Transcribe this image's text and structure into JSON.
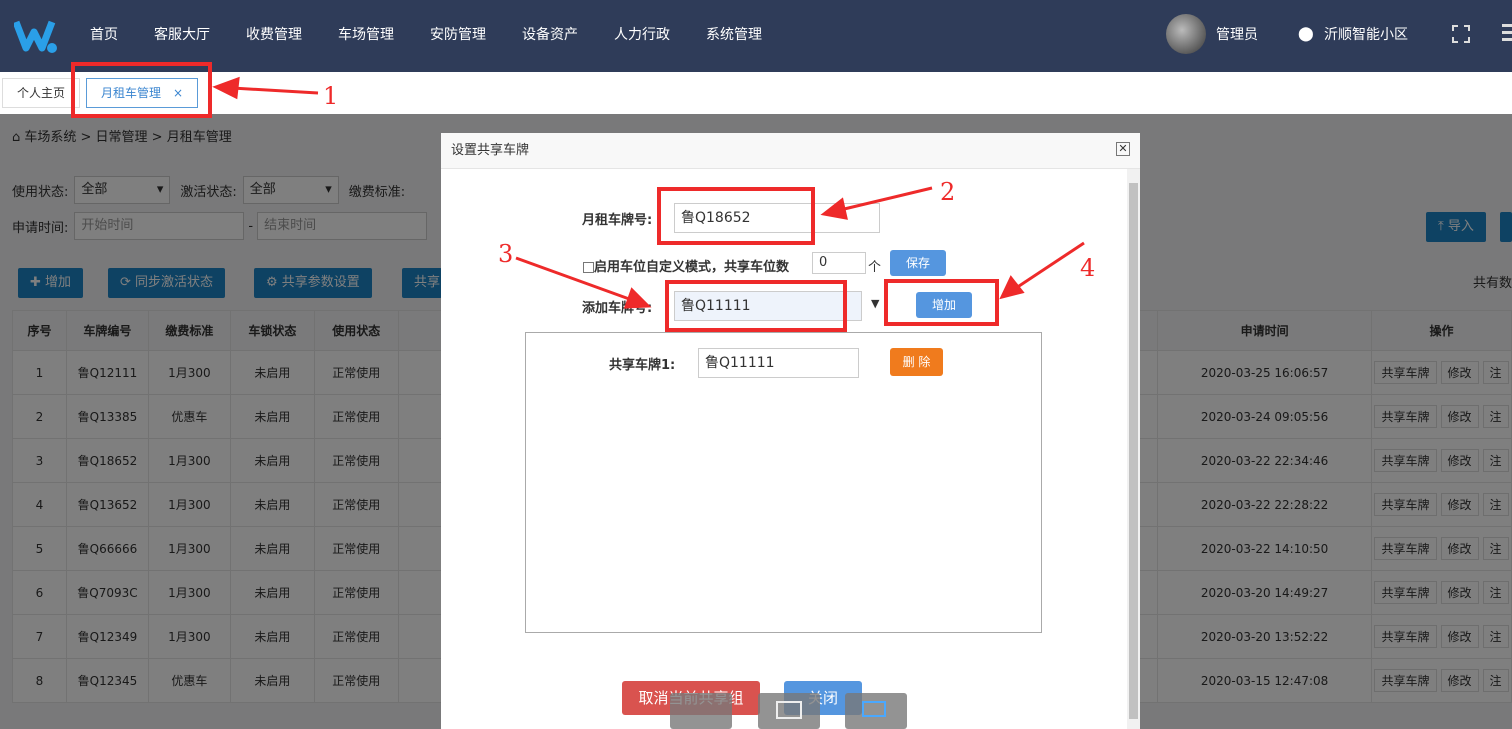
{
  "nav": {
    "items": [
      "首页",
      "客服大厅",
      "收费管理",
      "车场管理",
      "安防管理",
      "设备资产",
      "人力行政",
      "系统管理"
    ],
    "user": "管理员",
    "location": "沂顺智能小区"
  },
  "tabs": {
    "home": "个人主页",
    "active": "月租车管理",
    "close": "×"
  },
  "breadcrumb": "车场系统 > 日常管理 > 月租车管理",
  "filters": {
    "status_label": "使用状态:",
    "status_value": "全部",
    "activate_label": "激活状态:",
    "activate_value": "全部",
    "fee_label": "缴费标准:",
    "apply_label": "申请时间:",
    "start_placeholder": "开始时间",
    "end_placeholder": "结束时间",
    "dash": "-"
  },
  "toolbar": {
    "add": "✚ 增加",
    "sync": "同步激活状态",
    "share_settings": "共享参数设置",
    "share": "共享",
    "import": "导入",
    "total": "共有数"
  },
  "table": {
    "headers": [
      "序号",
      "车牌编号",
      "缴费标准",
      "车锁状态",
      "使用状态",
      "",
      "申请时间",
      "操作"
    ],
    "rows": [
      [
        "1",
        "鲁Q12111",
        "1月300",
        "未启用",
        "正常使用",
        "2020-03-25 16:06:57"
      ],
      [
        "2",
        "鲁Q13385",
        "优惠车",
        "未启用",
        "正常使用",
        "2020-03-24 09:05:56"
      ],
      [
        "3",
        "鲁Q18652",
        "1月300",
        "未启用",
        "正常使用",
        "2020-03-22 22:34:46"
      ],
      [
        "4",
        "鲁Q13652",
        "1月300",
        "未启用",
        "正常使用",
        "2020-03-22 22:28:22"
      ],
      [
        "5",
        "鲁Q66666",
        "1月300",
        "未启用",
        "正常使用",
        "2020-03-22 14:10:50"
      ],
      [
        "6",
        "鲁Q7093C",
        "1月300",
        "未启用",
        "正常使用",
        "2020-03-20 14:49:27"
      ],
      [
        "7",
        "鲁Q12349",
        "1月300",
        "未启用",
        "正常使用",
        "2020-03-20 13:52:22"
      ],
      [
        "8",
        "鲁Q12345",
        "优惠车",
        "未启用",
        "正常使用",
        "2020-03-15 12:47:08"
      ]
    ],
    "ops": [
      "共享车牌",
      "修改",
      "注"
    ]
  },
  "modal": {
    "title": "设置共享车牌",
    "monthly_label": "月租车牌号:",
    "monthly_value": "鲁Q18652",
    "custom_mode_label": "启用车位自定义模式，共享车位数",
    "slot_value": "0",
    "slot_unit": "个",
    "save": "保存",
    "add_label": "添加车牌号:",
    "add_value": "鲁Q11111",
    "add_button": "增加",
    "share_label": "共享车牌1:",
    "share_value": "鲁Q11111",
    "delete": "删 除",
    "cancel_group": "取消当前共享组",
    "close": "关闭"
  },
  "annotations": [
    "1",
    "2",
    "3",
    "4"
  ],
  "colors": {
    "nav_bg": "#2f3c59",
    "primary": "#1c84c6",
    "modal_btn": "#5596df",
    "delete": "#f07b1d",
    "danger": "#d9534f",
    "annotation": "#ee2a2a"
  }
}
